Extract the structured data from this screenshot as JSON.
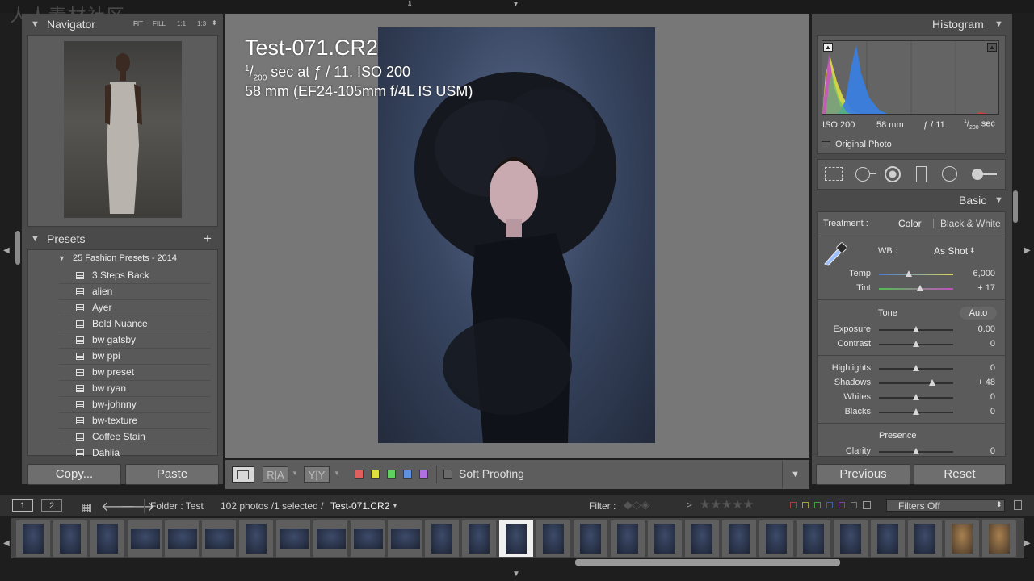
{
  "watermark": "人人素材社区",
  "navigator": {
    "title": "Navigator",
    "zoom_options": [
      "FIT",
      "FILL",
      "1:1",
      "1:3"
    ]
  },
  "presets": {
    "title": "Presets",
    "folder": "25 Fashion Presets - 2014",
    "items": [
      "3 Steps Back",
      "alien",
      "Ayer",
      "Bold Nuance",
      "bw gatsby",
      "bw ppi",
      "bw preset",
      "bw ryan",
      "bw-johnny",
      "bw-texture",
      "Coffee Stain",
      "Dahlia"
    ]
  },
  "left_buttons": {
    "copy": "Copy...",
    "paste": "Paste"
  },
  "photo_info": {
    "filename": "Test-071.CR2",
    "line2_sup": "1",
    "line2_sub": "200",
    "line2_rest": " sec at ƒ / 11, ISO 200",
    "line3": "58 mm (EF24-105mm f/4L IS USM)"
  },
  "toolbar": {
    "view1": "R|A",
    "view2": "Y|Y",
    "soft_proofing": "Soft Proofing",
    "color_swatches": [
      "#e06060",
      "#e0e040",
      "#60d060",
      "#6090e0",
      "#b070e0"
    ]
  },
  "histogram": {
    "title": "Histogram",
    "iso": "ISO 200",
    "focal": "58 mm",
    "aperture": "ƒ / 11",
    "shutter_sup": "1",
    "shutter_sub": "200",
    "shutter_unit": "sec",
    "original_photo": "Original Photo"
  },
  "basic": {
    "title": "Basic",
    "treatment_label": "Treatment :",
    "treatment_color": "Color",
    "treatment_bw": "Black & White",
    "wb_label": "WB :",
    "wb_value": "As Shot",
    "tone_label": "Tone",
    "auto_label": "Auto",
    "presence_label": "Presence",
    "sliders": [
      {
        "label": "Temp",
        "value": "6,000",
        "pos": 0.4
      },
      {
        "label": "Tint",
        "value": "+ 17",
        "pos": 0.55
      },
      {
        "label": "Exposure",
        "value": "0.00",
        "pos": 0.5
      },
      {
        "label": "Contrast",
        "value": "0",
        "pos": 0.5
      },
      {
        "label": "Highlights",
        "value": "0",
        "pos": 0.5
      },
      {
        "label": "Shadows",
        "value": "+ 48",
        "pos": 0.72
      },
      {
        "label": "Whites",
        "value": "0",
        "pos": 0.5
      },
      {
        "label": "Blacks",
        "value": "0",
        "pos": 0.5
      },
      {
        "label": "Clarity",
        "value": "0",
        "pos": 0.5
      }
    ]
  },
  "right_buttons": {
    "previous": "Previous",
    "reset": "Reset"
  },
  "filmstrip_bar": {
    "screen1": "1",
    "screen2": "2",
    "folder": "Folder : Test",
    "count": "102 photos /1 selected /",
    "current": "Test-071.CR2",
    "filter_label": "Filter :",
    "filter_ge": "≥",
    "filters_off": "Filters Off"
  }
}
